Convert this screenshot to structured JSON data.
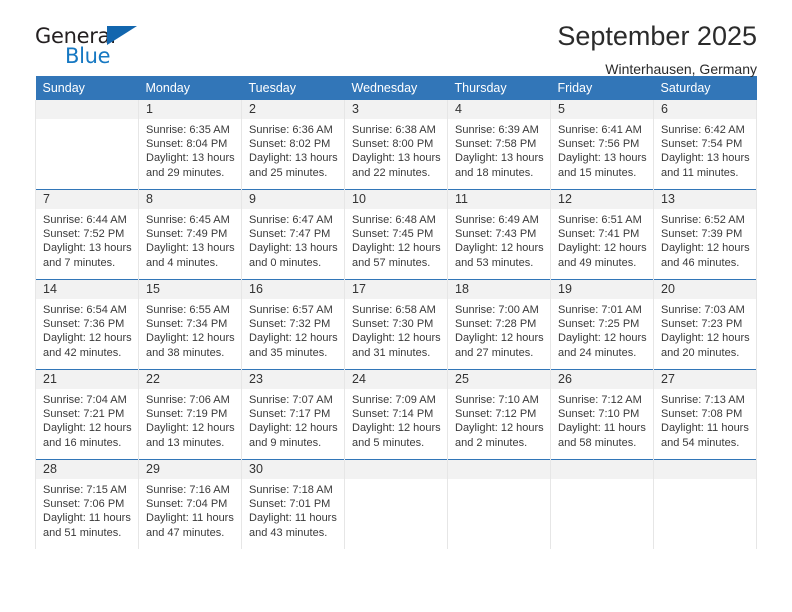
{
  "brand": {
    "word_one": "General",
    "word_two": "Blue",
    "accent_color": "#1678c2",
    "triangle_color": "#1266ae",
    "triangle_icon": "triangle-icon"
  },
  "header": {
    "title": "September 2025",
    "subtitle": "Winterhausen, Germany",
    "header_bg": "#3276b8",
    "header_text_color": "#ffffff",
    "daynum_bg": "#f2f2f2"
  },
  "weekdays": [
    "Sunday",
    "Monday",
    "Tuesday",
    "Wednesday",
    "Thursday",
    "Friday",
    "Saturday"
  ],
  "weeks": [
    [
      {
        "day": "",
        "sunrise": "",
        "sunset": "",
        "daylight_line1": "",
        "daylight_line2": "",
        "empty": true
      },
      {
        "day": "1",
        "sunrise": "Sunrise: 6:35 AM",
        "sunset": "Sunset: 8:04 PM",
        "daylight_line1": "Daylight: 13 hours",
        "daylight_line2": "and 29 minutes."
      },
      {
        "day": "2",
        "sunrise": "Sunrise: 6:36 AM",
        "sunset": "Sunset: 8:02 PM",
        "daylight_line1": "Daylight: 13 hours",
        "daylight_line2": "and 25 minutes."
      },
      {
        "day": "3",
        "sunrise": "Sunrise: 6:38 AM",
        "sunset": "Sunset: 8:00 PM",
        "daylight_line1": "Daylight: 13 hours",
        "daylight_line2": "and 22 minutes."
      },
      {
        "day": "4",
        "sunrise": "Sunrise: 6:39 AM",
        "sunset": "Sunset: 7:58 PM",
        "daylight_line1": "Daylight: 13 hours",
        "daylight_line2": "and 18 minutes."
      },
      {
        "day": "5",
        "sunrise": "Sunrise: 6:41 AM",
        "sunset": "Sunset: 7:56 PM",
        "daylight_line1": "Daylight: 13 hours",
        "daylight_line2": "and 15 minutes."
      },
      {
        "day": "6",
        "sunrise": "Sunrise: 6:42 AM",
        "sunset": "Sunset: 7:54 PM",
        "daylight_line1": "Daylight: 13 hours",
        "daylight_line2": "and 11 minutes."
      }
    ],
    [
      {
        "day": "7",
        "sunrise": "Sunrise: 6:44 AM",
        "sunset": "Sunset: 7:52 PM",
        "daylight_line1": "Daylight: 13 hours",
        "daylight_line2": "and 7 minutes."
      },
      {
        "day": "8",
        "sunrise": "Sunrise: 6:45 AM",
        "sunset": "Sunset: 7:49 PM",
        "daylight_line1": "Daylight: 13 hours",
        "daylight_line2": "and 4 minutes."
      },
      {
        "day": "9",
        "sunrise": "Sunrise: 6:47 AM",
        "sunset": "Sunset: 7:47 PM",
        "daylight_line1": "Daylight: 13 hours",
        "daylight_line2": "and 0 minutes."
      },
      {
        "day": "10",
        "sunrise": "Sunrise: 6:48 AM",
        "sunset": "Sunset: 7:45 PM",
        "daylight_line1": "Daylight: 12 hours",
        "daylight_line2": "and 57 minutes."
      },
      {
        "day": "11",
        "sunrise": "Sunrise: 6:49 AM",
        "sunset": "Sunset: 7:43 PM",
        "daylight_line1": "Daylight: 12 hours",
        "daylight_line2": "and 53 minutes."
      },
      {
        "day": "12",
        "sunrise": "Sunrise: 6:51 AM",
        "sunset": "Sunset: 7:41 PM",
        "daylight_line1": "Daylight: 12 hours",
        "daylight_line2": "and 49 minutes."
      },
      {
        "day": "13",
        "sunrise": "Sunrise: 6:52 AM",
        "sunset": "Sunset: 7:39 PM",
        "daylight_line1": "Daylight: 12 hours",
        "daylight_line2": "and 46 minutes."
      }
    ],
    [
      {
        "day": "14",
        "sunrise": "Sunrise: 6:54 AM",
        "sunset": "Sunset: 7:36 PM",
        "daylight_line1": "Daylight: 12 hours",
        "daylight_line2": "and 42 minutes."
      },
      {
        "day": "15",
        "sunrise": "Sunrise: 6:55 AM",
        "sunset": "Sunset: 7:34 PM",
        "daylight_line1": "Daylight: 12 hours",
        "daylight_line2": "and 38 minutes."
      },
      {
        "day": "16",
        "sunrise": "Sunrise: 6:57 AM",
        "sunset": "Sunset: 7:32 PM",
        "daylight_line1": "Daylight: 12 hours",
        "daylight_line2": "and 35 minutes."
      },
      {
        "day": "17",
        "sunrise": "Sunrise: 6:58 AM",
        "sunset": "Sunset: 7:30 PM",
        "daylight_line1": "Daylight: 12 hours",
        "daylight_line2": "and 31 minutes."
      },
      {
        "day": "18",
        "sunrise": "Sunrise: 7:00 AM",
        "sunset": "Sunset: 7:28 PM",
        "daylight_line1": "Daylight: 12 hours",
        "daylight_line2": "and 27 minutes."
      },
      {
        "day": "19",
        "sunrise": "Sunrise: 7:01 AM",
        "sunset": "Sunset: 7:25 PM",
        "daylight_line1": "Daylight: 12 hours",
        "daylight_line2": "and 24 minutes."
      },
      {
        "day": "20",
        "sunrise": "Sunrise: 7:03 AM",
        "sunset": "Sunset: 7:23 PM",
        "daylight_line1": "Daylight: 12 hours",
        "daylight_line2": "and 20 minutes."
      }
    ],
    [
      {
        "day": "21",
        "sunrise": "Sunrise: 7:04 AM",
        "sunset": "Sunset: 7:21 PM",
        "daylight_line1": "Daylight: 12 hours",
        "daylight_line2": "and 16 minutes."
      },
      {
        "day": "22",
        "sunrise": "Sunrise: 7:06 AM",
        "sunset": "Sunset: 7:19 PM",
        "daylight_line1": "Daylight: 12 hours",
        "daylight_line2": "and 13 minutes."
      },
      {
        "day": "23",
        "sunrise": "Sunrise: 7:07 AM",
        "sunset": "Sunset: 7:17 PM",
        "daylight_line1": "Daylight: 12 hours",
        "daylight_line2": "and 9 minutes."
      },
      {
        "day": "24",
        "sunrise": "Sunrise: 7:09 AM",
        "sunset": "Sunset: 7:14 PM",
        "daylight_line1": "Daylight: 12 hours",
        "daylight_line2": "and 5 minutes."
      },
      {
        "day": "25",
        "sunrise": "Sunrise: 7:10 AM",
        "sunset": "Sunset: 7:12 PM",
        "daylight_line1": "Daylight: 12 hours",
        "daylight_line2": "and 2 minutes."
      },
      {
        "day": "26",
        "sunrise": "Sunrise: 7:12 AM",
        "sunset": "Sunset: 7:10 PM",
        "daylight_line1": "Daylight: 11 hours",
        "daylight_line2": "and 58 minutes."
      },
      {
        "day": "27",
        "sunrise": "Sunrise: 7:13 AM",
        "sunset": "Sunset: 7:08 PM",
        "daylight_line1": "Daylight: 11 hours",
        "daylight_line2": "and 54 minutes."
      }
    ],
    [
      {
        "day": "28",
        "sunrise": "Sunrise: 7:15 AM",
        "sunset": "Sunset: 7:06 PM",
        "daylight_line1": "Daylight: 11 hours",
        "daylight_line2": "and 51 minutes."
      },
      {
        "day": "29",
        "sunrise": "Sunrise: 7:16 AM",
        "sunset": "Sunset: 7:04 PM",
        "daylight_line1": "Daylight: 11 hours",
        "daylight_line2": "and 47 minutes."
      },
      {
        "day": "30",
        "sunrise": "Sunrise: 7:18 AM",
        "sunset": "Sunset: 7:01 PM",
        "daylight_line1": "Daylight: 11 hours",
        "daylight_line2": "and 43 minutes."
      },
      {
        "day": "",
        "sunrise": "",
        "sunset": "",
        "daylight_line1": "",
        "daylight_line2": "",
        "empty": true
      },
      {
        "day": "",
        "sunrise": "",
        "sunset": "",
        "daylight_line1": "",
        "daylight_line2": "",
        "empty": true
      },
      {
        "day": "",
        "sunrise": "",
        "sunset": "",
        "daylight_line1": "",
        "daylight_line2": "",
        "empty": true
      },
      {
        "day": "",
        "sunrise": "",
        "sunset": "",
        "daylight_line1": "",
        "daylight_line2": "",
        "empty": true
      }
    ]
  ]
}
